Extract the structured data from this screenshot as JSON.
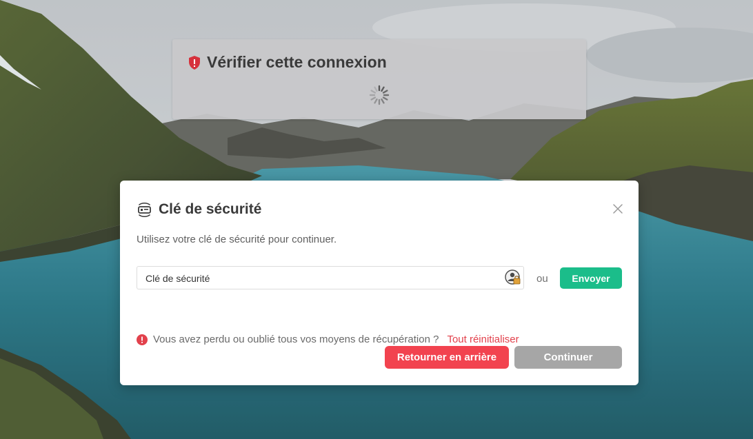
{
  "verify": {
    "title": "Vérifier cette connexion"
  },
  "modal": {
    "title": "Clé de sécurité",
    "subtitle": "Utilisez votre clé de sécurité pour continuer.",
    "field_value": "Clé de sécurité",
    "or_label": "ou",
    "send_label": "Envoyer",
    "recovery_text": "Vous avez perdu ou oublié tous vos moyens de récupération ?",
    "reset_link": "Tout réinitialiser",
    "back_label": "Retourner en arrière",
    "continue_label": "Continuer"
  },
  "icons": {
    "shield": "shield-alert-icon",
    "key": "security-key-icon",
    "close": "close-icon",
    "password_manager": "password-manager-icon",
    "error": "error-icon"
  },
  "colors": {
    "send": "#1bbd8a",
    "back": "#f2434f",
    "continue_disabled": "#a6a6a6",
    "link": "#e2414c",
    "shield": "#d6313c"
  }
}
